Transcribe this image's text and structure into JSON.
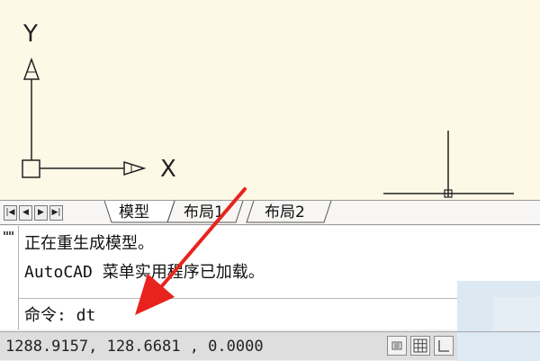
{
  "ucs": {
    "y_label": "Y",
    "x_label": "X"
  },
  "layout_tabs": {
    "nav_buttons": [
      "first",
      "prev",
      "next",
      "last"
    ],
    "tabs": [
      {
        "label": "模型",
        "active": true
      },
      {
        "label": "布局1",
        "active": false
      },
      {
        "label": "布局2",
        "active": false
      }
    ]
  },
  "command": {
    "history": [
      "正在重生成模型。",
      "AutoCAD 菜单实用程序已加载。"
    ],
    "prompt": "命令: dt"
  },
  "status_bar": {
    "coordinates": "1288.9157, 128.6681 , 0.0000",
    "buttons": [
      "snap-icon",
      "grid-icon",
      "ortho-icon"
    ]
  },
  "colors": {
    "canvas": "#fdf9e6",
    "arrow": "#e8231d",
    "panel": "#dce8f2"
  }
}
